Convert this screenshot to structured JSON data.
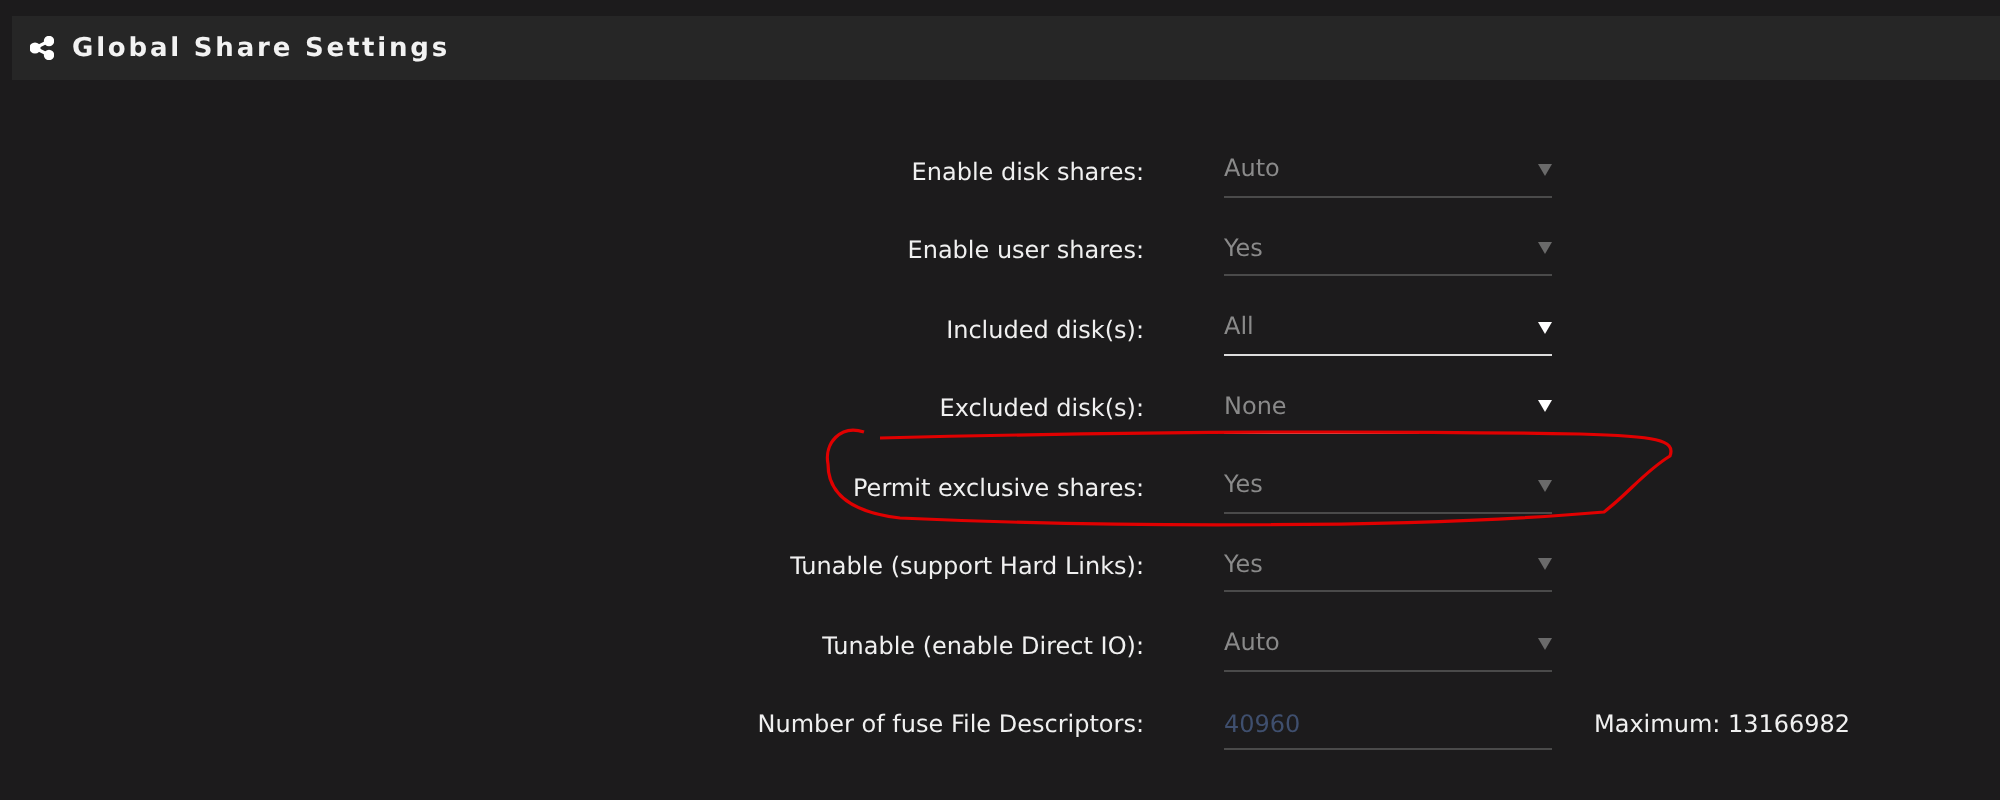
{
  "header": {
    "title": "Global Share Settings"
  },
  "settings": [
    {
      "kind": "select",
      "label": "Enable disk shares:",
      "value": "Auto",
      "disabled": true,
      "circled": false
    },
    {
      "kind": "select",
      "label": "Enable user shares:",
      "value": "Yes",
      "disabled": true,
      "circled": false
    },
    {
      "kind": "select",
      "label": "Included disk(s):",
      "value": "All",
      "disabled": false,
      "circled": false
    },
    {
      "kind": "select",
      "label": "Excluded disk(s):",
      "value": "None",
      "disabled": false,
      "circled": false
    },
    {
      "kind": "select",
      "label": "Permit exclusive shares:",
      "value": "Yes",
      "disabled": true,
      "circled": true
    },
    {
      "kind": "select",
      "label": "Tunable (support Hard Links):",
      "value": "Yes",
      "disabled": true,
      "circled": false
    },
    {
      "kind": "select",
      "label": "Tunable (enable Direct IO):",
      "value": "Auto",
      "disabled": true,
      "circled": false
    },
    {
      "kind": "input",
      "label": "Number of fuse File Descriptors:",
      "placeholder": "40960",
      "note": "Maximum: 13166982",
      "circled": false
    }
  ]
}
